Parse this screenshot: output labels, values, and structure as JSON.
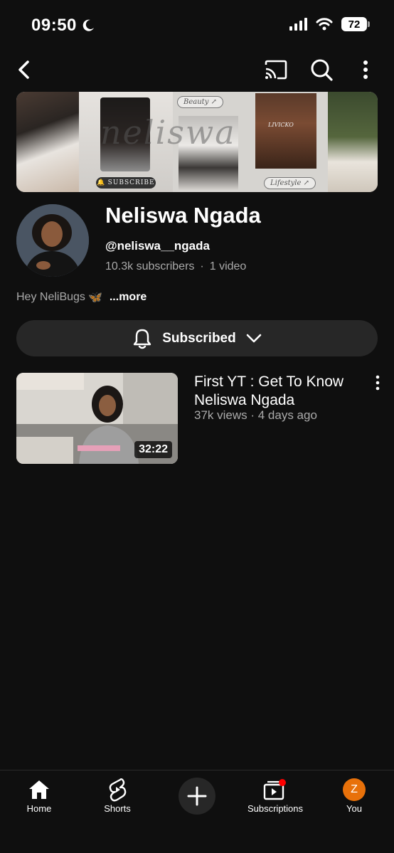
{
  "status_bar": {
    "time": "09:50",
    "battery": "72"
  },
  "channel": {
    "name": "Neliswa Ngada",
    "handle": "@neliswa__ngada",
    "subscribers": "10.3k subscribers",
    "separator": "·",
    "video_count": "1 video",
    "bio": "Hey NeliBugs",
    "bio_emoji": "🦋",
    "more_label": "...more",
    "subscribe_state": "Subscribed"
  },
  "banner": {
    "script_text": "neliswa",
    "chip_beauty": "Beauty ↗",
    "chip_lifestyle": "Lifestyle ↗",
    "subscribe_text": "SUBSCRIBE",
    "brand_text": "LIVICKO"
  },
  "videos": [
    {
      "title": "First YT : Get To Know Neliswa Ngada",
      "meta": "37k views · 4 days ago",
      "duration": "32:22"
    }
  ],
  "bottom_nav": {
    "home": "Home",
    "shorts": "Shorts",
    "subscriptions": "Subscriptions",
    "you": "You",
    "you_initial": "Z"
  },
  "colors": {
    "background": "#0f0f0f",
    "accent_you": "#e8710a",
    "notification_dot": "#ff0000"
  }
}
